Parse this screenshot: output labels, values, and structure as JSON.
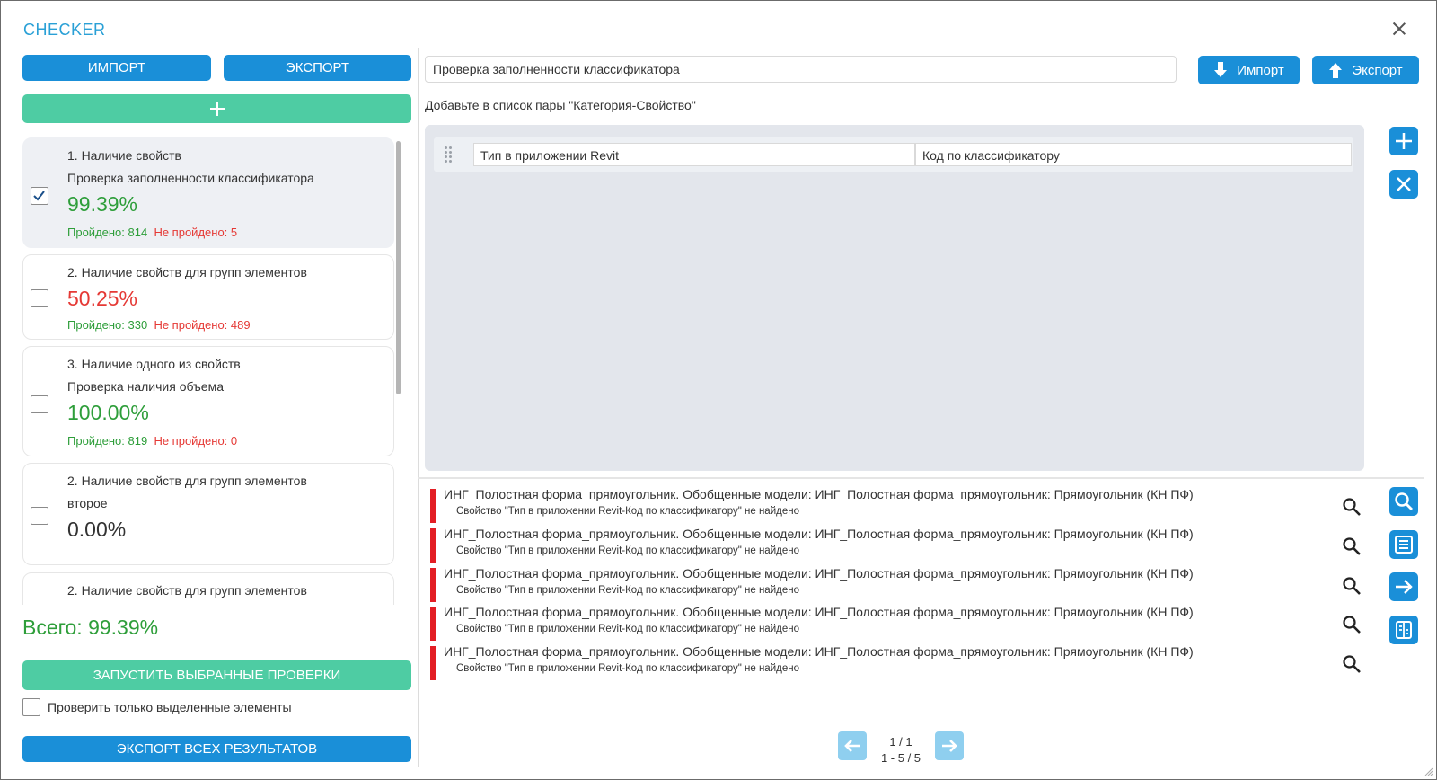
{
  "window": {
    "title": "CHECKER",
    "close_icon": "close-icon"
  },
  "left": {
    "import_label": "ИМПОРТ",
    "export_label": "ЭКСПОРТ",
    "add_icon": "plus-icon",
    "checks": [
      {
        "title": "1. Наличие свойств",
        "subtitle": "Проверка заполненности классификатора",
        "percent": "99.39%",
        "percent_color": "green",
        "passed": "Пройдено: 814",
        "failed": "Не пройдено: 5",
        "checked": true
      },
      {
        "title": "2. Наличие свойств для групп элементов",
        "subtitle": "",
        "percent": "50.25%",
        "percent_color": "red",
        "passed": "Пройдено: 330",
        "failed": "Не пройдено: 489",
        "checked": false
      },
      {
        "title": "3. Наличие одного из свойств",
        "subtitle": "Проверка наличия объема",
        "percent": "100.00%",
        "percent_color": "green",
        "passed": "Пройдено: 819",
        "failed": "Не пройдено: 0",
        "checked": false
      },
      {
        "title": "2. Наличие свойств для групп элементов",
        "subtitle": "второе",
        "percent": "0.00%",
        "percent_color": "dark",
        "passed": "",
        "failed": "",
        "checked": false
      },
      {
        "title": "2. Наличие свойств для групп элементов",
        "subtitle": "",
        "percent": "",
        "percent_color": "dark",
        "passed": "",
        "failed": "",
        "checked": false
      }
    ],
    "total": "Всего: 99.39%",
    "run_label": "ЗАПУСТИТЬ ВЫБРАННЫЕ ПРОВЕРКИ",
    "only_selected_label": "Проверить только выделенные элементы",
    "export_all_label": "ЭКСПОРТ ВСЕХ РЕЗУЛЬТАТОВ"
  },
  "right": {
    "rule_name": "Проверка заполненности классификатора",
    "import_label": "Импорт",
    "export_label": "Экспорт",
    "hint": "Добавьте в список пары \"Категория-Свойство\"",
    "pair": {
      "category": "Тип в приложении Revit",
      "property": "Код по классификатору"
    },
    "side_buttons": [
      "plus-icon",
      "close-icon"
    ],
    "errors": [
      {
        "line1": "ИНГ_Полостная форма_прямоугольник. Обобщенные модели: ИНГ_Полостная форма_прямоугольник: Прямоугольник (КН ПФ)",
        "line2": "Свойство \"Тип в приложении Revit-Код по классификатору\" не найдено"
      },
      {
        "line1": "ИНГ_Полостная форма_прямоугольник. Обобщенные модели: ИНГ_Полостная форма_прямоугольник: Прямоугольник (КН ПФ)",
        "line2": "Свойство \"Тип в приложении Revit-Код по классификатору\" не найдено"
      },
      {
        "line1": "ИНГ_Полостная форма_прямоугольник. Обобщенные модели: ИНГ_Полостная форма_прямоугольник: Прямоугольник (КН ПФ)",
        "line2": "Свойство \"Тип в приложении Revit-Код по классификатору\" не найдено"
      },
      {
        "line1": "ИНГ_Полостная форма_прямоугольник. Обобщенные модели: ИНГ_Полостная форма_прямоугольник: Прямоугольник (КН ПФ)",
        "line2": "Свойство \"Тип в приложении Revit-Код по классификатору\" не найдено"
      },
      {
        "line1": "ИНГ_Полостная форма_прямоугольник. Обобщенные модели: ИНГ_Полостная форма_прямоугольник: Прямоугольник (КН ПФ)",
        "line2": "Свойство \"Тип в приложении Revit-Код по классификатору\" не найдено"
      }
    ],
    "result_tools": [
      "search-icon",
      "list-icon",
      "arrow-right-icon",
      "compare-icon"
    ],
    "pager": {
      "page": "1 / 1",
      "range": "1 - 5 / 5"
    }
  },
  "colors": {
    "accent": "#1a8fd8",
    "green_button": "#4ecca3",
    "pass": "#2e9e3a",
    "fail": "#e53935",
    "error_bar": "#e31e24",
    "panel": "#e3e6ec"
  }
}
